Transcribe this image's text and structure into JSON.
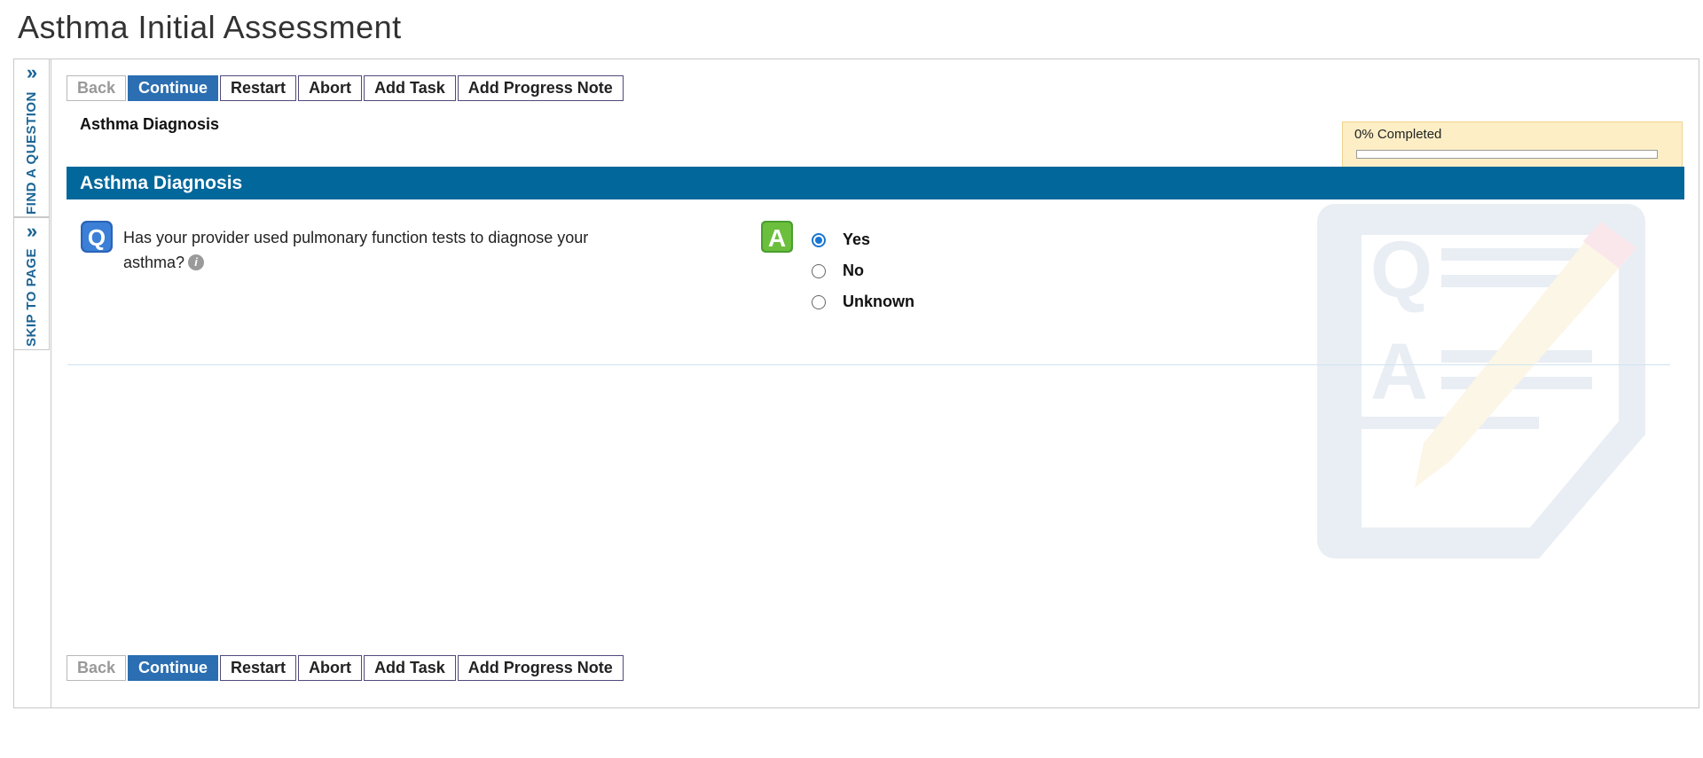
{
  "page": {
    "title": "Asthma Initial Assessment"
  },
  "sidebar": {
    "find_label": "FIND A QUESTION",
    "skip_label": "SKIP TO PAGE",
    "chevron": "»"
  },
  "toolbar": {
    "back": "Back",
    "continue": "Continue",
    "restart": "Restart",
    "abort": "Abort",
    "add_task": "Add Task",
    "add_progress_note": "Add Progress Note"
  },
  "breadcrumb": "Asthma Diagnosis",
  "progress": {
    "label": "0% Completed",
    "percent": 0
  },
  "section": {
    "title": "Asthma Diagnosis"
  },
  "question": {
    "icon": "Q",
    "text": "Has your provider used pulmonary function tests to diagnose your asthma?",
    "info_icon": "i"
  },
  "answer": {
    "icon": "A",
    "options": [
      {
        "label": "Yes",
        "selected": true
      },
      {
        "label": "No",
        "selected": false
      },
      {
        "label": "Unknown",
        "selected": false
      }
    ]
  },
  "colors": {
    "section_bar": "#02679a",
    "primary_button": "#2b6eb1",
    "progress_box": "#fdeec6",
    "sidebar_text": "#1a6496"
  }
}
